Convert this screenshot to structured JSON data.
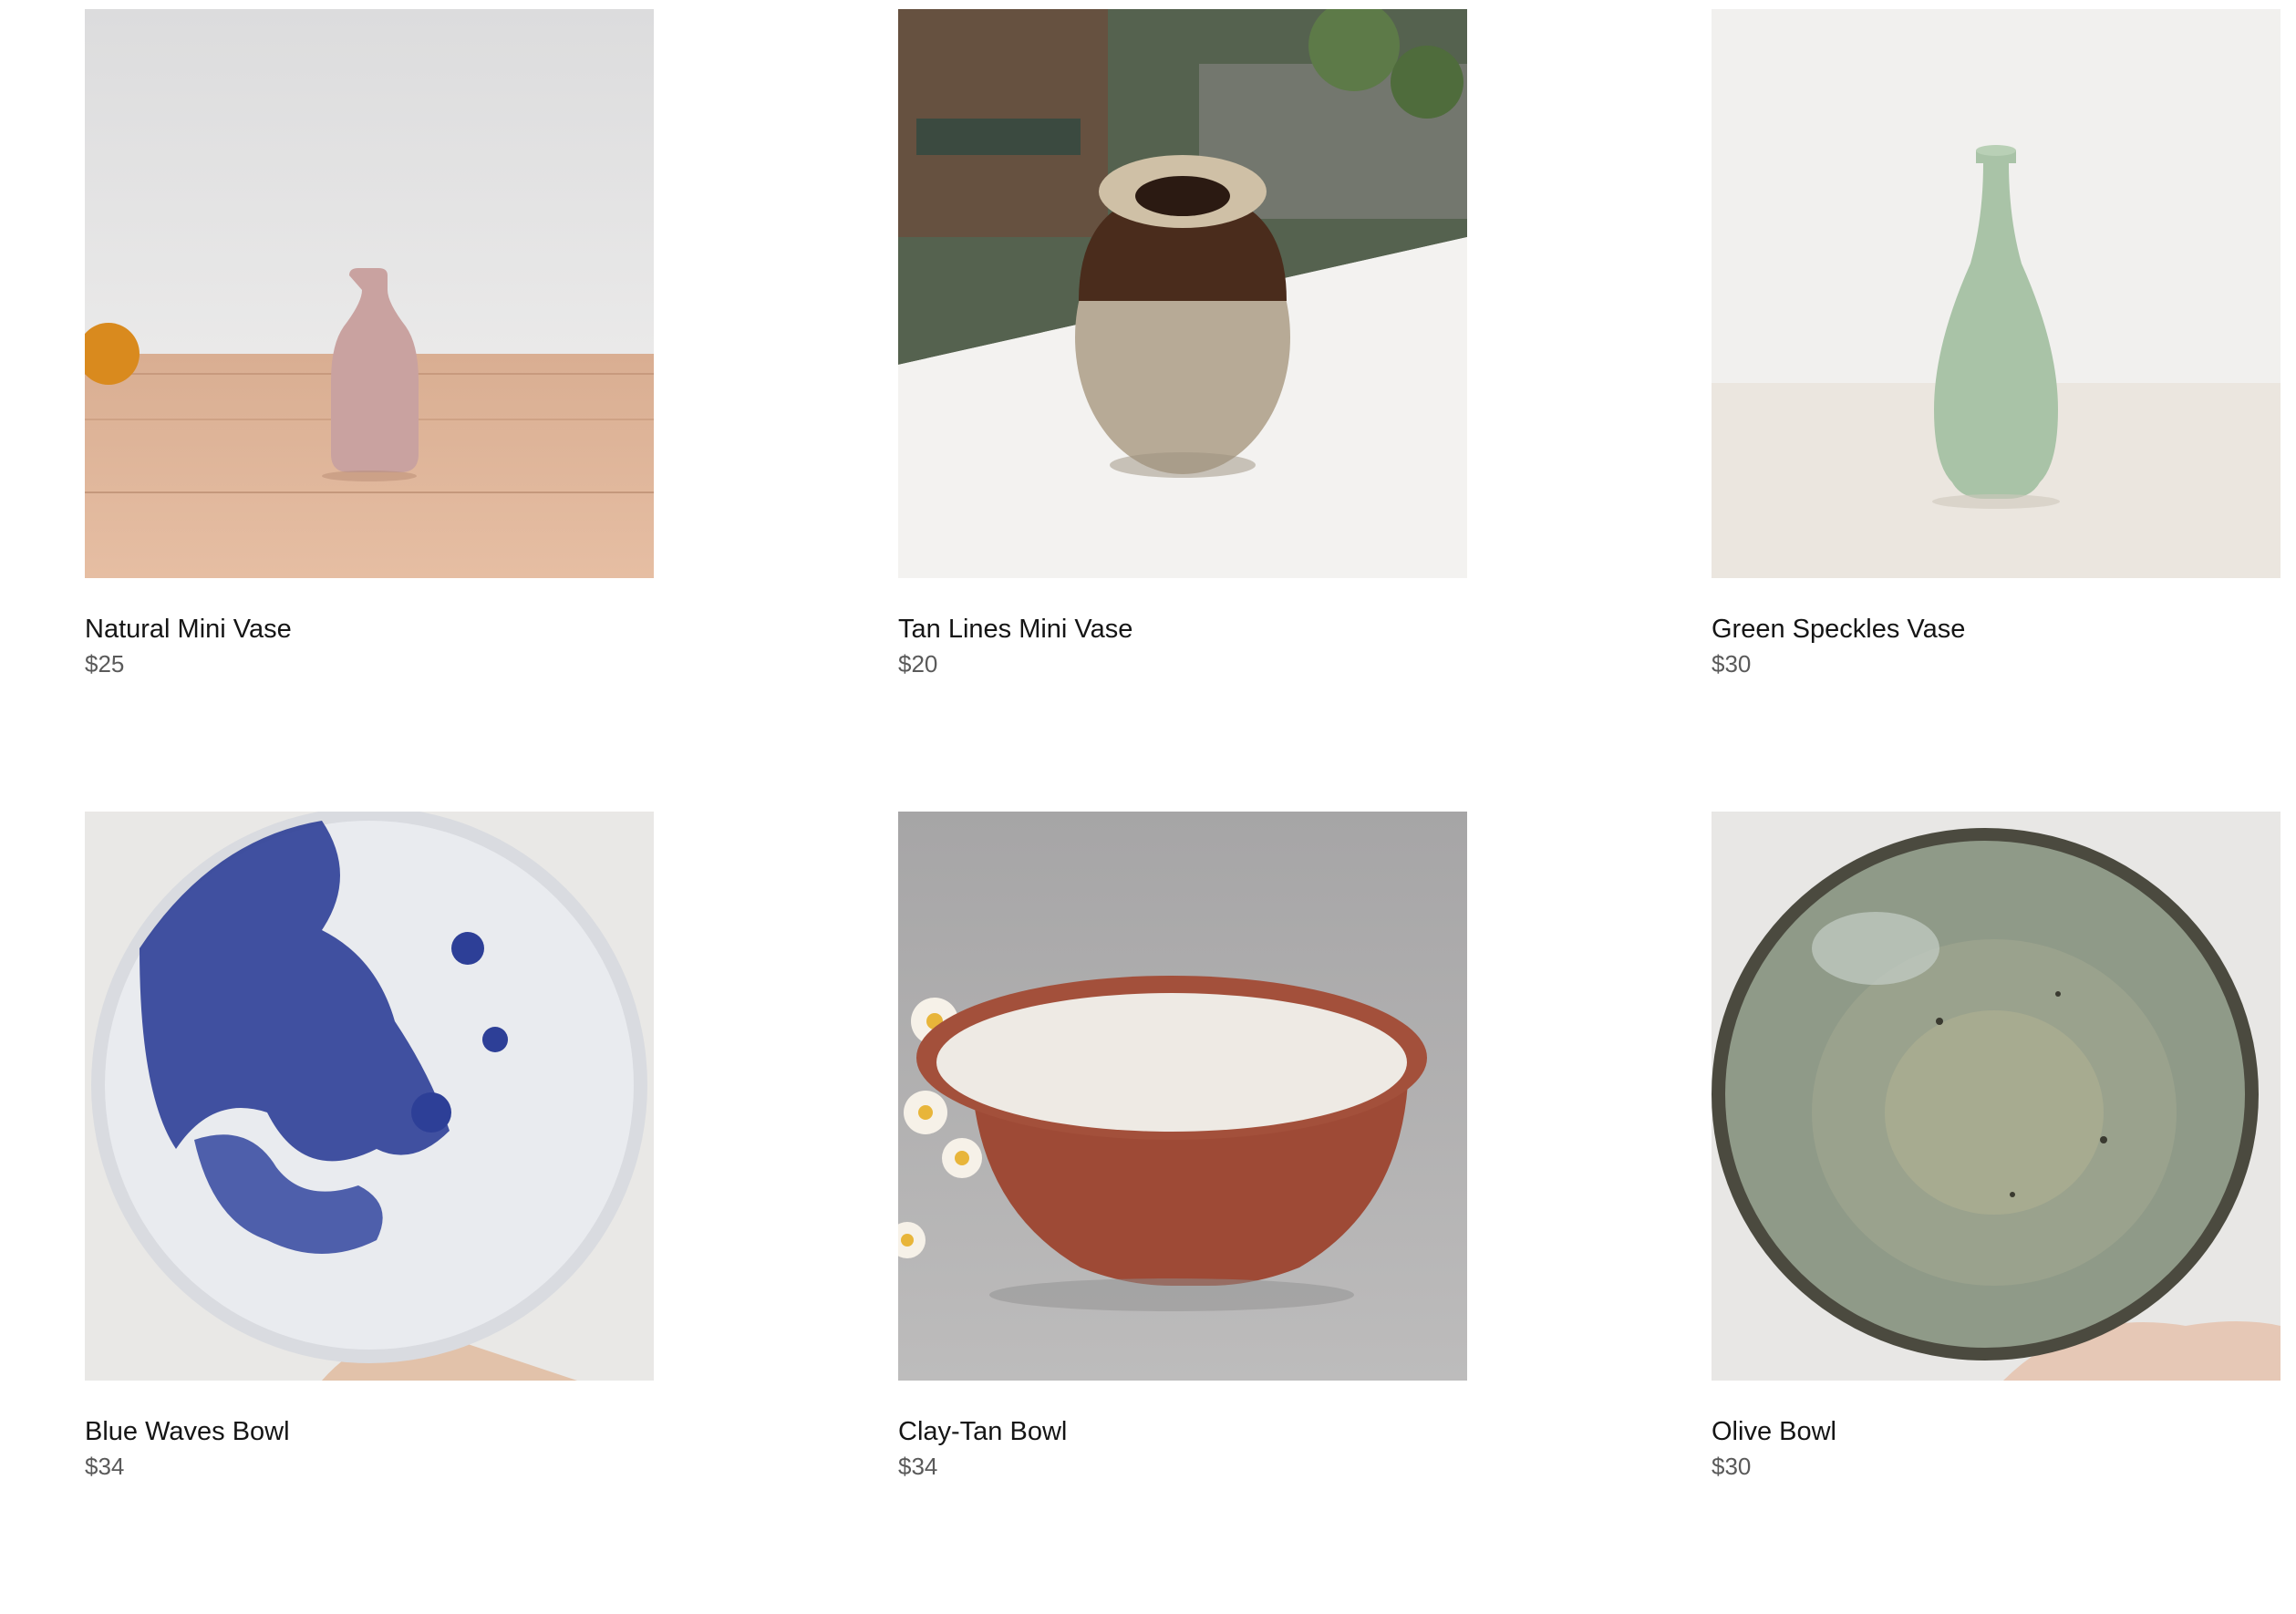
{
  "products": [
    {
      "name": "Natural Mini Vase",
      "price": "$25",
      "image_icon": "natural-mini-vase-photo",
      "colors": {
        "bg_top": "#e4e3e3",
        "table": "#d8a888",
        "vase": "#c9a2a0",
        "accent": "#d98a1e"
      }
    },
    {
      "name": "Tan Lines Mini Vase",
      "price": "$20",
      "image_icon": "tan-lines-mini-vase-photo",
      "colors": {
        "bg_top": "#4a5a4e",
        "table": "#f2f1ef",
        "vase_top": "#4a2c1c",
        "vase_bottom": "#b3a592"
      }
    },
    {
      "name": "Green Speckles Vase",
      "price": "$30",
      "image_icon": "green-speckles-vase-photo",
      "colors": {
        "bg_top": "#f1f0ee",
        "table": "#ebe7e0",
        "vase": "#a9c3a7"
      }
    },
    {
      "name": "Blue Waves Bowl",
      "price": "$34",
      "image_icon": "blue-waves-bowl-photo",
      "colors": {
        "bg": "#e9e8e6",
        "bowl": "#e8eaf0",
        "pattern": "#2d3f97"
      }
    },
    {
      "name": "Clay-Tan Bowl",
      "price": "$34",
      "image_icon": "clay-tan-bowl-photo",
      "colors": {
        "bg": "#a8a8a8",
        "bowl_outer": "#9e4a36",
        "bowl_inner": "#eeeae4"
      }
    },
    {
      "name": "Olive Bowl",
      "price": "$30",
      "image_icon": "olive-bowl-photo",
      "colors": {
        "bg": "#e8e7e5",
        "bowl": "#8f9a88",
        "rim": "#4b4a3f"
      }
    }
  ]
}
